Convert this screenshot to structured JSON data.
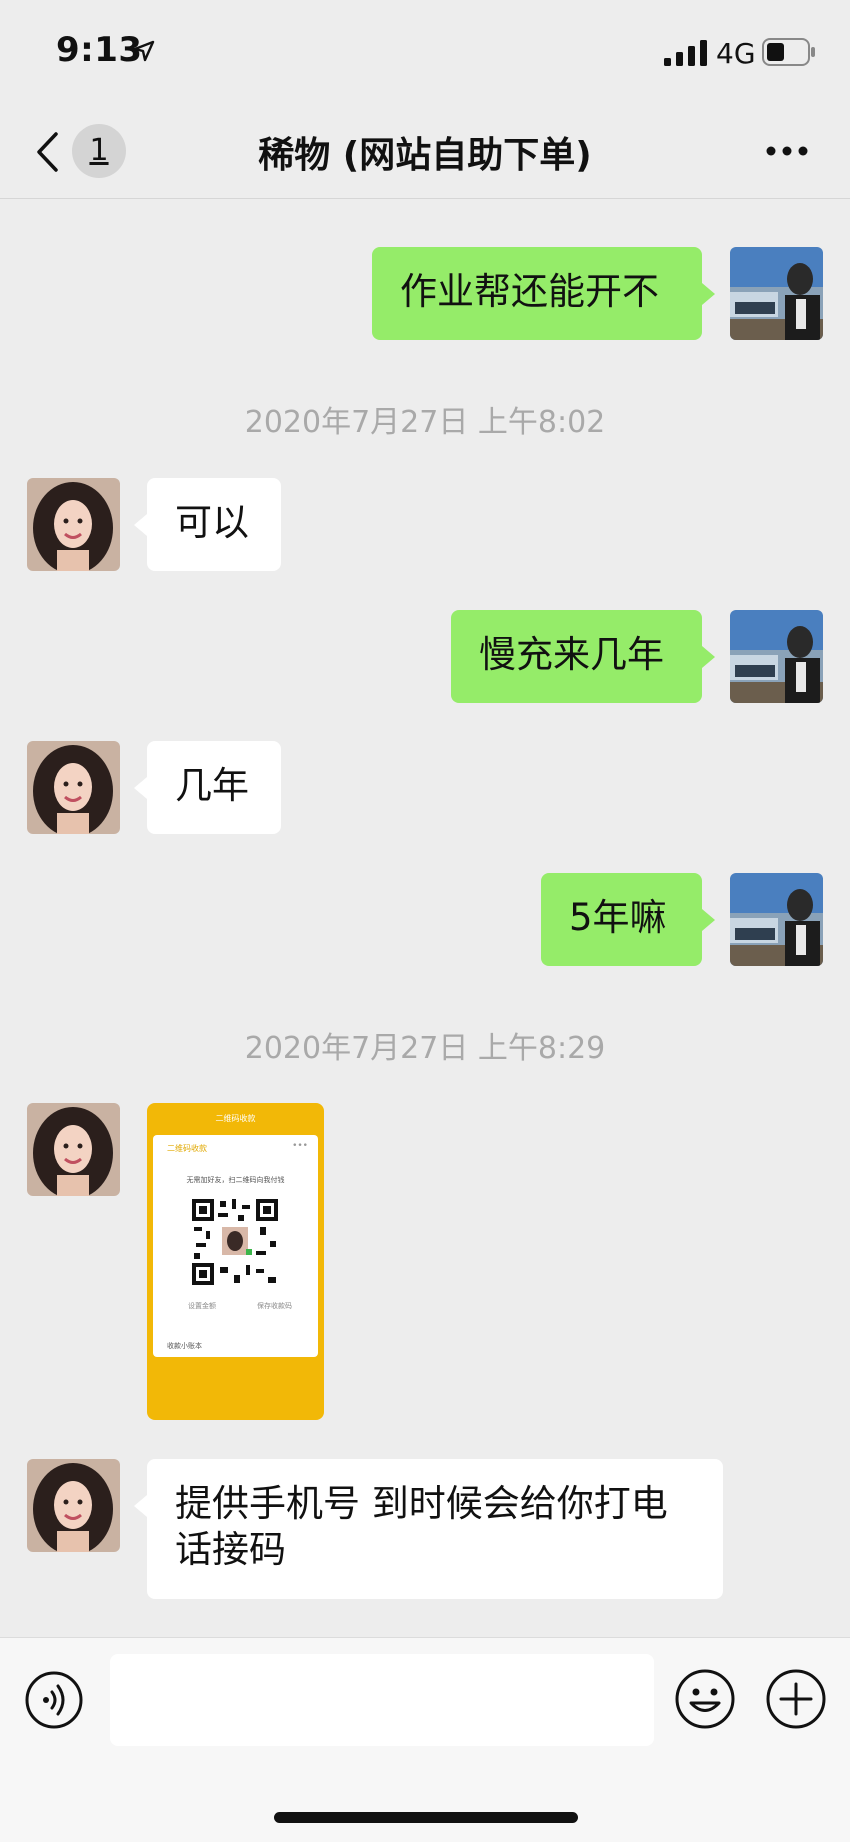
{
  "status_bar": {
    "time": "9:13",
    "network": "4G"
  },
  "nav": {
    "unread_count": "1",
    "title": "稀物 (网站自助下单)"
  },
  "messages": [
    {
      "text": "作业帮还能开不"
    },
    {
      "timestamp": "2020年7月27日 上午8:02"
    },
    {
      "text": "可以"
    },
    {
      "text": "慢充来几年"
    },
    {
      "text": "几年"
    },
    {
      "text": "5年嘛"
    },
    {
      "timestamp": "2020年7月27日 上午8:29"
    },
    {
      "image": {
        "header": "二维码收款",
        "card_title": "二维码收款",
        "hint": "无需加好友，扫二维码向我付钱",
        "link_left": "设置金额",
        "link_right": "保存收款码",
        "footer": "收款小账本"
      }
    },
    {
      "text": "提供手机号 到时候会给你打电话接码"
    }
  ],
  "colors": {
    "sent_bubble": "#95ec69",
    "received_bubble": "#ffffff",
    "background": "#ededed"
  },
  "icons": [
    "location-arrow-icon",
    "signal-icon",
    "battery-icon",
    "back-chevron-icon",
    "more-dots-icon",
    "voice-icon",
    "emoji-icon",
    "plus-icon"
  ]
}
